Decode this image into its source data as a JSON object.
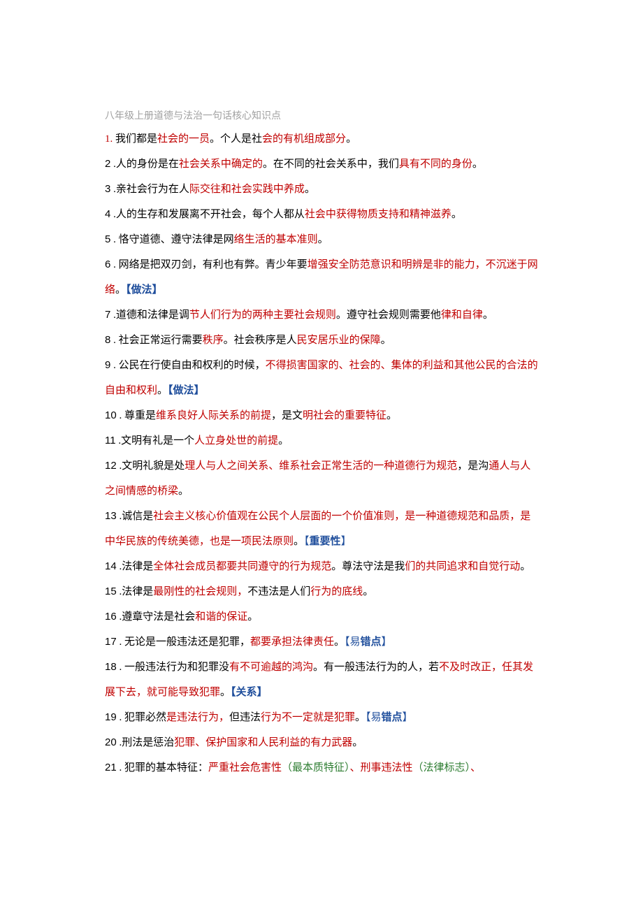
{
  "title": "八年级上册道德与法治一句话核心知识点",
  "items": [
    {
      "num": "1.",
      "numStyle": "red",
      "runs": [
        {
          "t": " 我们都是",
          "c": "black"
        },
        {
          "t": "社会的一员",
          "c": "red"
        },
        {
          "t": "。个人是社",
          "c": "black"
        },
        {
          "t": "会的有机组成部分",
          "c": "red"
        },
        {
          "t": "。",
          "c": "black"
        }
      ]
    },
    {
      "num": "2",
      "numStyle": "sans",
      "runs": [
        {
          "t": " .人的身份是在",
          "c": "black"
        },
        {
          "t": "社会关系中确定的",
          "c": "red"
        },
        {
          "t": "。在不同的社会关系中，我们",
          "c": "black"
        },
        {
          "t": "具有不同的身份",
          "c": "red"
        },
        {
          "t": "。",
          "c": "black"
        }
      ]
    },
    {
      "num": "3",
      "numStyle": "sans",
      "runs": [
        {
          "t": " .亲社会行为在人",
          "c": "black"
        },
        {
          "t": "际交往和社会实践中养成",
          "c": "red"
        },
        {
          "t": "。",
          "c": "black"
        }
      ]
    },
    {
      "num": "4",
      "numStyle": "sans",
      "runs": [
        {
          "t": " .人的生存和发展离不开社会，每个人都从",
          "c": "black"
        },
        {
          "t": "社会中获得物质支持和精神滋养",
          "c": "red"
        },
        {
          "t": "。",
          "c": "black"
        }
      ]
    },
    {
      "num": "5",
      "numStyle": "sans",
      "runs": [
        {
          "t": " . 恪守道德、遵守法律是网",
          "c": "black"
        },
        {
          "t": "络生活的基本准则",
          "c": "red"
        },
        {
          "t": "。",
          "c": "black"
        }
      ]
    },
    {
      "num": "6",
      "numStyle": "sans",
      "runs": [
        {
          "t": " . 网络是把双刃剑，有利也有弊。青少年要",
          "c": "black"
        },
        {
          "t": "增强安全防范意识和明辨是非的能力，不沉迷于网络",
          "c": "red"
        },
        {
          "t": "。",
          "c": "black"
        },
        {
          "t": "【做法】",
          "c": "blue-b"
        }
      ]
    },
    {
      "num": "7",
      "numStyle": "sans",
      "runs": [
        {
          "t": " .道德和法律是调",
          "c": "black"
        },
        {
          "t": "节人们行为的两种主要社会规则",
          "c": "red"
        },
        {
          "t": "。遵守社会规则需要他",
          "c": "black"
        },
        {
          "t": "律和自律",
          "c": "red"
        },
        {
          "t": "。",
          "c": "black"
        }
      ]
    },
    {
      "num": "8",
      "numStyle": "sans",
      "runs": [
        {
          "t": " . 社会正常运行需要",
          "c": "black"
        },
        {
          "t": "秩序",
          "c": "red"
        },
        {
          "t": "。社会秩序是人",
          "c": "black"
        },
        {
          "t": "民安居乐业的保障",
          "c": "red"
        },
        {
          "t": "。",
          "c": "black"
        }
      ]
    },
    {
      "num": "9",
      "numStyle": "sans",
      "runs": [
        {
          "t": " . 公民在行使自由和权利的时候，",
          "c": "black"
        },
        {
          "t": "不得损害国家的、社会的、集体的利益和其他公民的合法的自由和权利",
          "c": "red"
        },
        {
          "t": "。",
          "c": "black"
        },
        {
          "t": "【做法】",
          "c": "blue-b"
        }
      ]
    },
    {
      "num": "10",
      "numStyle": "sans",
      "runs": [
        {
          "t": " . 尊重是",
          "c": "black"
        },
        {
          "t": "维系良好人际关系的前提",
          "c": "red"
        },
        {
          "t": "，是文",
          "c": "black"
        },
        {
          "t": "明社会的重要特征",
          "c": "red"
        },
        {
          "t": "。",
          "c": "black"
        }
      ]
    },
    {
      "num": "11",
      "numStyle": "sans",
      "runs": [
        {
          "t": " .文明有礼是一个",
          "c": "black"
        },
        {
          "t": "人立身处世的前提",
          "c": "red"
        },
        {
          "t": "。",
          "c": "black"
        }
      ]
    },
    {
      "num": "12",
      "numStyle": "sans",
      "runs": [
        {
          "t": " .文明礼貌是处",
          "c": "black"
        },
        {
          "t": "理人与人之间关系、维系社会正常生活的一种道德行为规范",
          "c": "red"
        },
        {
          "t": "，是沟",
          "c": "black"
        },
        {
          "t": "通人与人之间情感的桥梁",
          "c": "red"
        },
        {
          "t": "。",
          "c": "black"
        }
      ]
    },
    {
      "num": "13",
      "numStyle": "sans",
      "runs": [
        {
          "t": " .诚信是",
          "c": "black"
        },
        {
          "t": "社会主义核心价值观在公民个人层面的一个价值准则，是一种道德规范和品质，是中华民族的传统美德，也是一项民法原则",
          "c": "red"
        },
        {
          "t": "。",
          "c": "black"
        },
        {
          "t": "【",
          "c": "blue"
        },
        {
          "t": "重要性",
          "c": "blue-b"
        },
        {
          "t": "】",
          "c": "blue"
        }
      ]
    },
    {
      "num": "14",
      "numStyle": "sans",
      "runs": [
        {
          "t": " .法律是",
          "c": "black"
        },
        {
          "t": "全体社会成员都要共同遵守的行为规范",
          "c": "red"
        },
        {
          "t": "。尊法守法是我",
          "c": "black"
        },
        {
          "t": "们的共同追求和自觉行动",
          "c": "red"
        },
        {
          "t": "。",
          "c": "black"
        }
      ]
    },
    {
      "num": "15",
      "numStyle": "sans",
      "runs": [
        {
          "t": " .法律是",
          "c": "black"
        },
        {
          "t": "最刚性的社会规则，",
          "c": "red"
        },
        {
          "t": "不违法是人们",
          "c": "black"
        },
        {
          "t": "行为的底线",
          "c": "red"
        },
        {
          "t": "。",
          "c": "black"
        }
      ]
    },
    {
      "num": "16",
      "numStyle": "sans",
      "runs": [
        {
          "t": " .遵章守法是社会",
          "c": "black"
        },
        {
          "t": "和谐的保证",
          "c": "red"
        },
        {
          "t": "。",
          "c": "black"
        }
      ]
    },
    {
      "num": "17",
      "numStyle": "sans",
      "runs": [
        {
          "t": " . 无论是一般违法还是犯罪，",
          "c": "black"
        },
        {
          "t": "都要承担法律责任",
          "c": "red"
        },
        {
          "t": "。",
          "c": "black"
        },
        {
          "t": "【易",
          "c": "blue"
        },
        {
          "t": "错点",
          "c": "blue-b"
        },
        {
          "t": "】",
          "c": "blue"
        }
      ]
    },
    {
      "num": "18",
      "numStyle": "sans",
      "runs": [
        {
          "t": " . 一般违法行为和犯罪没",
          "c": "black"
        },
        {
          "t": "有不可逾越的鸿沟",
          "c": "red"
        },
        {
          "t": "。有一般违法行为的人，若",
          "c": "black"
        },
        {
          "t": "不及时改正，任其发展下去，就可能导致犯罪",
          "c": "red"
        },
        {
          "t": "。",
          "c": "black"
        },
        {
          "t": "【关系】",
          "c": "blue-b"
        }
      ]
    },
    {
      "num": "19",
      "numStyle": "sans",
      "runs": [
        {
          "t": " . 犯罪必然",
          "c": "black"
        },
        {
          "t": "是违法行为，",
          "c": "red"
        },
        {
          "t": "但违法",
          "c": "black"
        },
        {
          "t": "行为不一定就是犯罪",
          "c": "red"
        },
        {
          "t": "。",
          "c": "black"
        },
        {
          "t": "【易",
          "c": "blue"
        },
        {
          "t": "错点",
          "c": "blue-b"
        },
        {
          "t": "】",
          "c": "blue"
        }
      ]
    },
    {
      "num": "20",
      "numStyle": "sans",
      "runs": [
        {
          "t": " .刑法是惩治",
          "c": "black"
        },
        {
          "t": "犯罪、保护国家和人民利益的有力武器",
          "c": "red"
        },
        {
          "t": "。",
          "c": "black"
        }
      ]
    },
    {
      "num": "21",
      "numStyle": "sans",
      "runs": [
        {
          "t": " . 犯罪的基本特征：",
          "c": "black"
        },
        {
          "t": "严重社会危害性",
          "c": "red"
        },
        {
          "t": "（最本质特征）",
          "c": "green"
        },
        {
          "t": "、",
          "c": "red"
        },
        {
          "t": "刑事违法性",
          "c": "red"
        },
        {
          "t": "（法律标志）",
          "c": "green"
        },
        {
          "t": "、",
          "c": "red"
        }
      ]
    }
  ]
}
